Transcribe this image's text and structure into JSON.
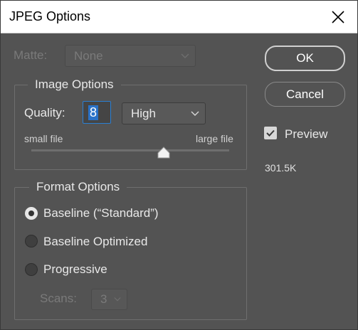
{
  "window": {
    "title": "JPEG Options"
  },
  "matte": {
    "label": "Matte:",
    "value": "None"
  },
  "image_options": {
    "title": "Image Options",
    "quality_label": "Quality:",
    "quality_value": "8",
    "quality_preset": "High",
    "small_file_label": "small file",
    "large_file_label": "large file",
    "quality_level": 8,
    "quality_max": 12
  },
  "format_options": {
    "title": "Format Options",
    "options": [
      {
        "label": "Baseline (“Standard”)",
        "selected": true
      },
      {
        "label": "Baseline Optimized",
        "selected": false
      },
      {
        "label": "Progressive",
        "selected": false
      }
    ],
    "scans_label": "Scans:",
    "scans_value": "3"
  },
  "buttons": {
    "ok": "OK",
    "cancel": "Cancel"
  },
  "preview": {
    "label": "Preview",
    "checked": true,
    "file_size": "301.5K"
  },
  "icons": {
    "close": "close-icon",
    "chevron": "chevron-down-icon",
    "checkmark": "checkmark-icon",
    "slider_thumb": "slider-thumb-icon"
  },
  "colors": {
    "dialog_bg": "#535353",
    "titlebar_bg": "#ffffff",
    "accent": "#2a72c8",
    "text": "#e8e8e8",
    "disabled_text": "#7a7a7a"
  }
}
